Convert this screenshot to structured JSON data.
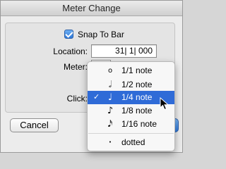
{
  "dialog": {
    "title": "Meter Change",
    "snap_label": "Snap To Bar",
    "snap_checked": true,
    "location_label": "Location:",
    "location_value": "31| 1| 000",
    "meter_label": "Meter:",
    "meter_value": "",
    "click_label": "Click:",
    "cancel_label": "Cancel"
  },
  "menu": {
    "items": [
      {
        "icon": "whole-note-icon",
        "glyph": "𝅝",
        "label": "1/1 note",
        "checked": false
      },
      {
        "icon": "half-note-icon",
        "glyph": "♩",
        "label": "1/2 note",
        "checked": false
      },
      {
        "icon": "quarter-note-icon",
        "glyph": "♩",
        "label": "1/4 note",
        "checked": true
      },
      {
        "icon": "eighth-note-icon",
        "glyph": "♪",
        "label": "1/8 note",
        "checked": false
      },
      {
        "icon": "sixteenth-note-icon",
        "glyph": "♬",
        "label": "1/16 note",
        "checked": false
      }
    ],
    "dotted": {
      "icon": "dot-icon",
      "glyph": "•",
      "label": "dotted"
    },
    "check_glyph": "✓"
  },
  "colors": {
    "accent": "#2f6bd7"
  }
}
